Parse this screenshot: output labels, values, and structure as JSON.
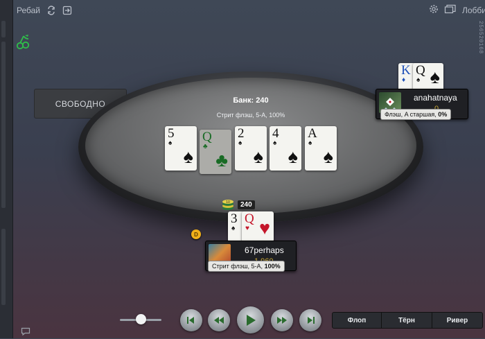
{
  "topbar": {
    "rebuy_label": "Ребай",
    "lobby_label": "Лобби",
    "hand_id": "256520168"
  },
  "table": {
    "pot_label": "Банк: 240",
    "hand_description": "Стрит флэш, 5-A, 100%",
    "board": [
      {
        "rank": "5",
        "suit": "♠",
        "color": "black",
        "dim": false
      },
      {
        "rank": "Q",
        "suit": "♣",
        "color": "green",
        "dim": true
      },
      {
        "rank": "2",
        "suit": "♠",
        "color": "black",
        "dim": false
      },
      {
        "rank": "4",
        "suit": "♠",
        "color": "black",
        "dim": false
      },
      {
        "rank": "A",
        "suit": "♠",
        "color": "black",
        "dim": false
      }
    ]
  },
  "seat_empty": {
    "label": "СВОБОДНО"
  },
  "opponent": {
    "name": "anahatnaya",
    "stack": "0",
    "hand_label": "Флэш, A старшая,",
    "hand_pct": "0%",
    "cards": [
      {
        "rank": "K",
        "suit": "♦",
        "color": "blue"
      },
      {
        "rank": "Q",
        "suit": "♠",
        "color": "black"
      }
    ]
  },
  "hero": {
    "name": "67perhaps",
    "stack": "1 960",
    "hand_label": "Стрит флэш, 5-A,",
    "hand_pct": "100%",
    "bet": "240",
    "dealer_label": "D",
    "chip_label": "10",
    "cards": [
      {
        "rank": "3",
        "suit": "♠",
        "color": "black"
      },
      {
        "rank": "Q",
        "suit": "♥",
        "color": "red"
      }
    ]
  },
  "replay_controls": {
    "speed_value": 0.5,
    "streets": [
      "Флоп",
      "Тёрн",
      "Ривер"
    ]
  },
  "colors": {
    "accent_green": "#2fbf4a",
    "dealer_button": "#f1b01a",
    "stack_gold": "#c9a838"
  }
}
